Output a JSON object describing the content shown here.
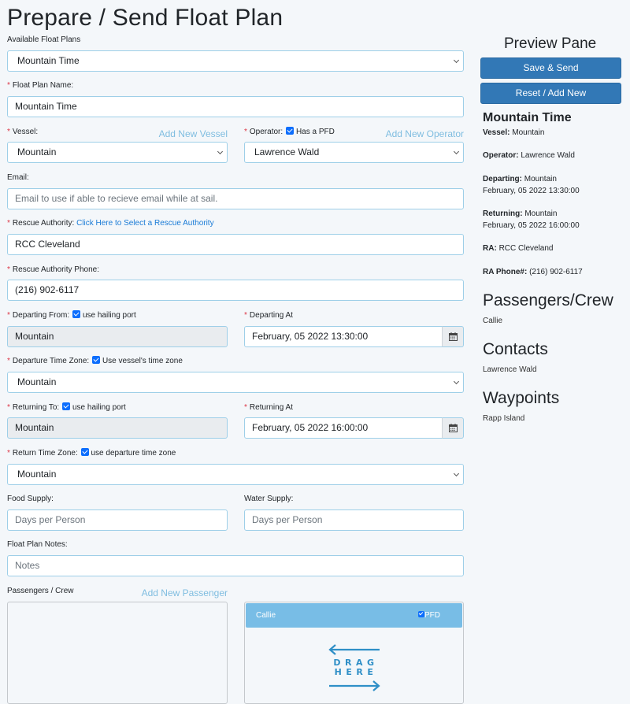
{
  "page": {
    "title": "Prepare / Send Float Plan"
  },
  "form": {
    "available_plans": {
      "label": "Available Float Plans",
      "value": "Mountain Time"
    },
    "plan_name": {
      "label": "Float Plan Name:",
      "value": "Mountain Time"
    },
    "vessel": {
      "label": "Vessel:",
      "value": "Mountain",
      "add_link": "Add New Vessel"
    },
    "operator": {
      "label": "Operator:",
      "checkbox_label": "Has a PFD",
      "checked": true,
      "value": "Lawrence Wald",
      "add_link": "Add New Operator"
    },
    "email": {
      "label": "Email:",
      "placeholder": "Email to use if able to recieve email while at sail."
    },
    "rescue_authority": {
      "label": "Rescue Authority:",
      "link": "Click Here to Select a Rescue Authority",
      "value": "RCC Cleveland"
    },
    "rescue_phone": {
      "label": "Rescue Authority Phone:",
      "value": "(216) 902-6117"
    },
    "departing_from": {
      "label": "Departing From:",
      "checkbox_label": "use hailing port",
      "checked": true,
      "value": "Mountain"
    },
    "departing_at": {
      "label": "Departing At",
      "value": "February, 05 2022 13:30:00"
    },
    "departure_tz": {
      "label": "Departure Time Zone:",
      "checkbox_label": "Use vessel's time zone",
      "checked": true,
      "value": "Mountain"
    },
    "returning_to": {
      "label": "Returning To:",
      "checkbox_label": "use hailing port",
      "checked": true,
      "value": "Mountain"
    },
    "returning_at": {
      "label": "Returning At",
      "value": "February, 05 2022 16:00:00"
    },
    "return_tz": {
      "label": "Return Time Zone:",
      "checkbox_label": "use departure time zone",
      "checked": true,
      "value": "Mountain"
    },
    "food_supply": {
      "label": "Food Supply:",
      "placeholder": "Days per Person"
    },
    "water_supply": {
      "label": "Water Supply:",
      "placeholder": "Days per Person"
    },
    "notes": {
      "label": "Float Plan Notes:",
      "placeholder": "Notes"
    },
    "passengers": {
      "label": "Passengers / Crew",
      "add_link": "Add New Passenger",
      "selected": [
        {
          "name": "Callie",
          "pfd_label": "PFD",
          "pfd": true
        }
      ],
      "drag_text_1": "DRAG",
      "drag_text_2": "HERE"
    }
  },
  "preview": {
    "heading": "Preview Pane",
    "save_button": "Save & Send",
    "reset_button": "Reset / Add New",
    "plan_name": "Mountain Time",
    "rows": {
      "vessel": {
        "label": "Vessel:",
        "value": "Mountain"
      },
      "operator": {
        "label": "Operator:",
        "value": "Lawrence Wald"
      },
      "departing": {
        "label": "Departing:",
        "value": "Mountain",
        "datetime": "February, 05 2022 13:30:00"
      },
      "returning": {
        "label": "Returning:",
        "value": "Mountain",
        "datetime": "February, 05 2022 16:00:00"
      },
      "ra": {
        "label": "RA:",
        "value": "RCC Cleveland"
      },
      "ra_phone": {
        "label": "RA Phone#:",
        "value": "(216) 902-6117"
      }
    },
    "sections": {
      "passengers": {
        "heading": "Passengers/Crew",
        "items": [
          "Callie"
        ]
      },
      "contacts": {
        "heading": "Contacts",
        "items": [
          "Lawrence Wald"
        ]
      },
      "waypoints": {
        "heading": "Waypoints",
        "items": [
          "Rapp Island"
        ]
      }
    }
  },
  "colors": {
    "primary_button": "#3278b6",
    "link": "#1a7bd6",
    "add_link": "#7fbde0",
    "input_border": "#9ecfe8",
    "crew_card": "#78bde6",
    "required": "#dc3545",
    "drag_arrows": "#2f8fc7"
  }
}
